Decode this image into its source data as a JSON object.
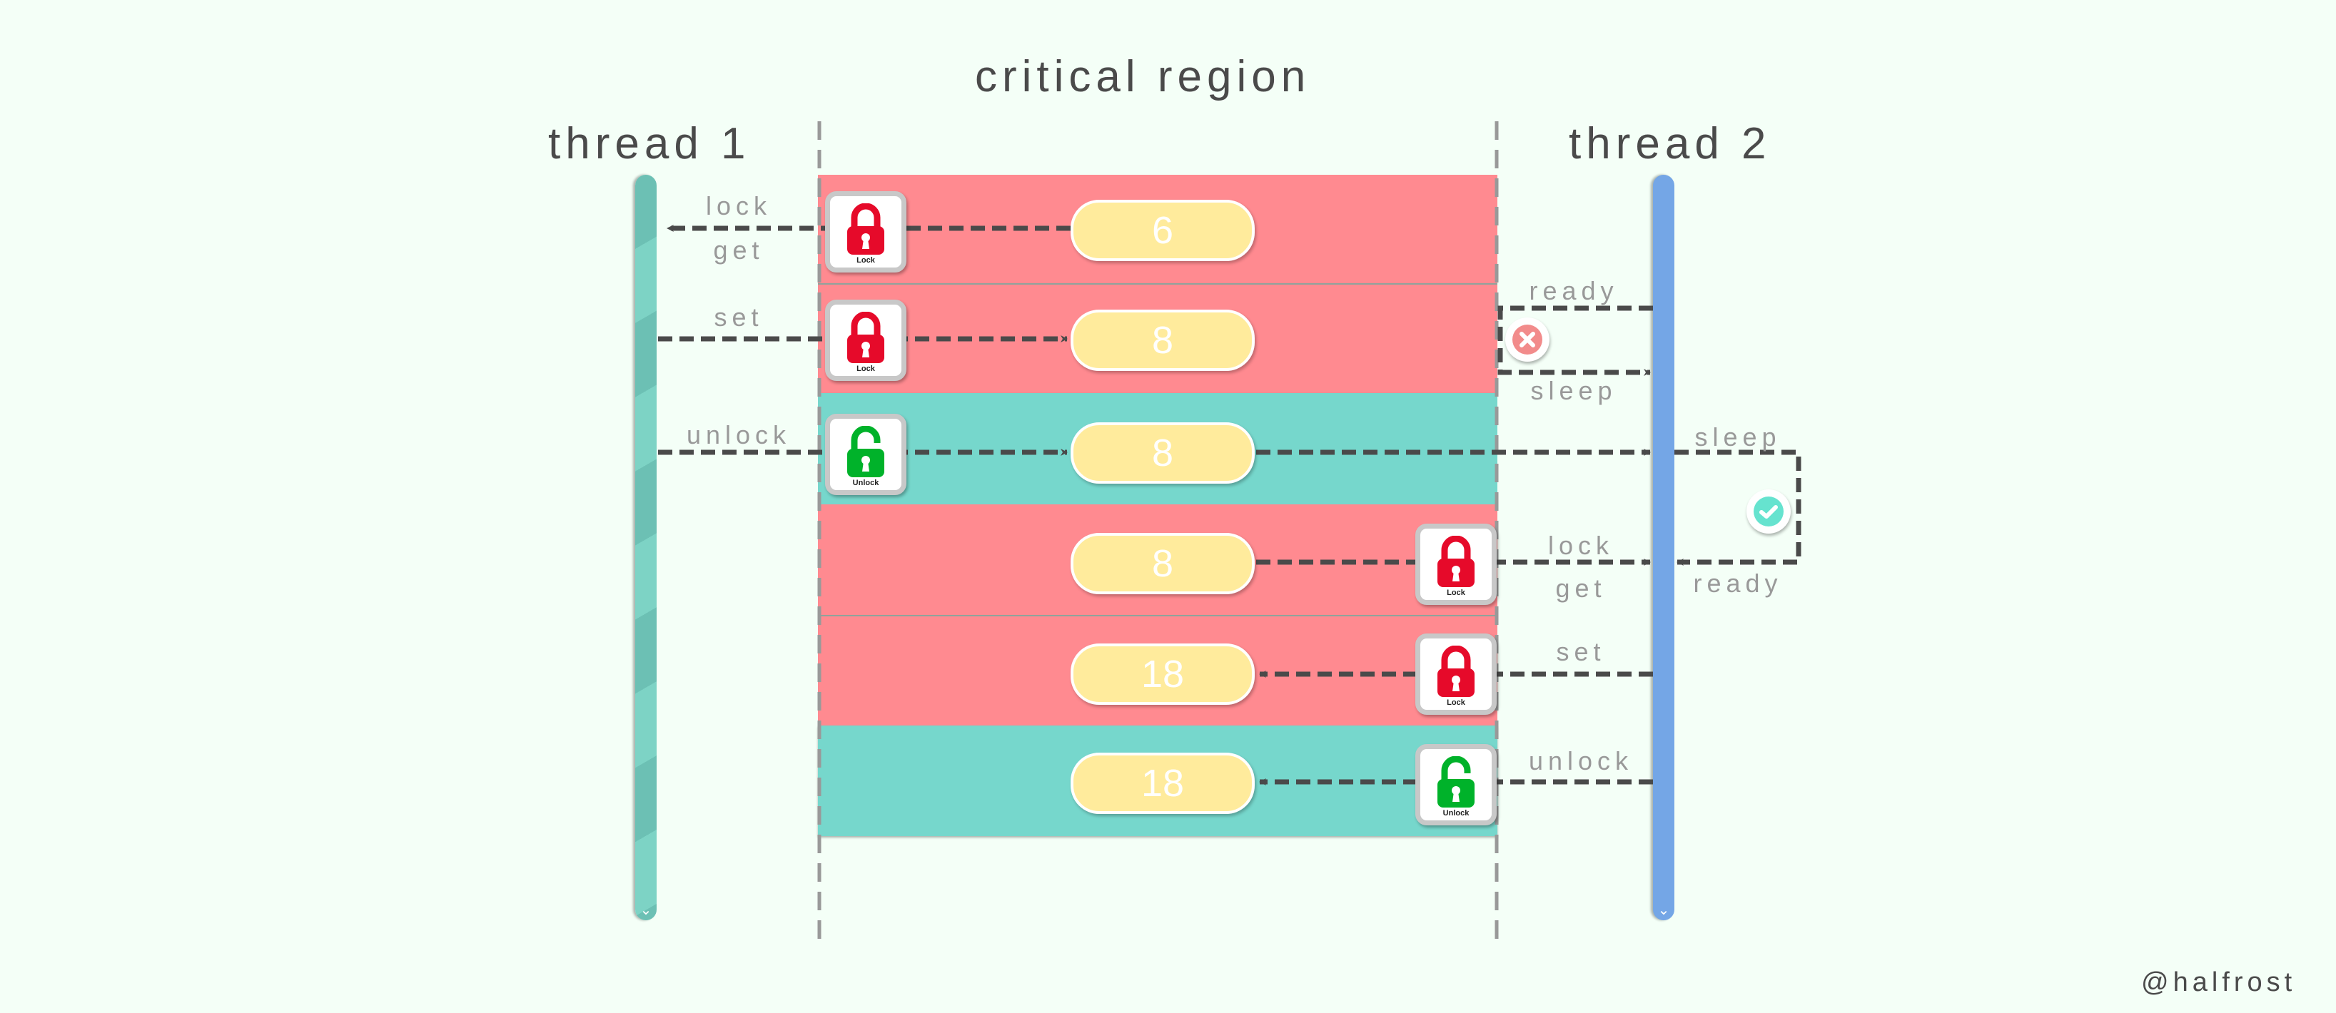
{
  "header": {
    "title": "critical region"
  },
  "threads": [
    {
      "id": "thread-1",
      "label": "thread 1",
      "color": "#76d1c3"
    },
    {
      "id": "thread-2",
      "label": "thread 2",
      "color": "#74a6e6"
    }
  ],
  "colors": {
    "locked": "#ff8a90",
    "unlocked": "#76d7cc",
    "value": "#ffeb9c",
    "arrow": "#4a4a4a",
    "lock_red": "#e60a2a",
    "lock_green": "#00b22a",
    "fail": "#f28b8b",
    "success": "#66e3cf"
  },
  "steps": [
    {
      "state": "locked",
      "value": "6",
      "actor": "thread 1",
      "lock": "Lock",
      "left_labels": [
        "lock",
        "get"
      ]
    },
    {
      "state": "locked",
      "value": "8",
      "actor": "thread 1",
      "lock": "Lock",
      "left_labels": [
        "set"
      ],
      "right_labels": [
        "ready",
        "sleep"
      ],
      "right_status": "fail"
    },
    {
      "state": "unlocked",
      "value": "8",
      "actor": "thread 1",
      "lock": "Unlock",
      "left_labels": [
        "unlock"
      ],
      "right_labels": [
        "sleep",
        "ready"
      ],
      "right_status": "success"
    },
    {
      "state": "locked",
      "value": "8",
      "actor": "thread 2",
      "lock": "Lock",
      "right_labels": [
        "lock",
        "get"
      ]
    },
    {
      "state": "locked",
      "value": "18",
      "actor": "thread 2",
      "lock": "Lock",
      "right_labels": [
        "set"
      ]
    },
    {
      "state": "unlocked",
      "value": "18",
      "actor": "thread 2",
      "lock": "Unlock",
      "right_labels": [
        "unlock"
      ]
    }
  ],
  "watermark": "@halfrost"
}
